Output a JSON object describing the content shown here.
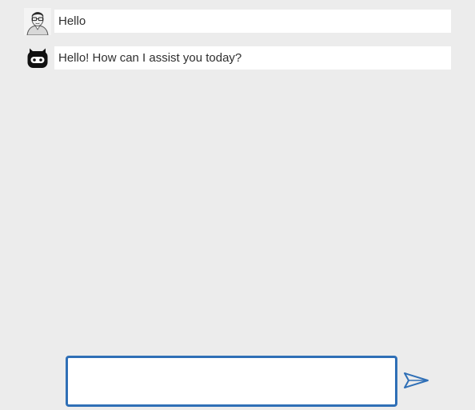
{
  "messages": [
    {
      "role": "user",
      "avatar_icon": "user-avatar-icon",
      "text": "Hello"
    },
    {
      "role": "bot",
      "avatar_icon": "robot-avatar-icon",
      "text": "Hello! How can I assist you today?"
    }
  ],
  "composer": {
    "value": "",
    "placeholder": ""
  },
  "send_button": {
    "icon": "send-icon"
  },
  "colors": {
    "background": "#ececec",
    "bubble": "#ffffff",
    "accent": "#2f6fb6",
    "text": "#2f2f2f"
  }
}
